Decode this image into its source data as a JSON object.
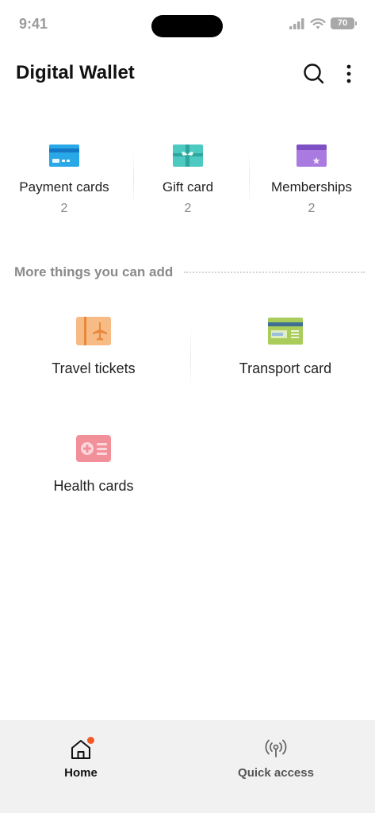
{
  "status_bar": {
    "time": "9:41",
    "battery": "70",
    "icons": [
      "signal-icon",
      "wifi-icon",
      "battery-icon"
    ]
  },
  "header": {
    "title": "Digital Wallet",
    "icons": [
      "search-icon",
      "more-vertical-icon"
    ]
  },
  "categories": [
    {
      "label": "Payment cards",
      "count": "2",
      "icon": "payment-card-icon",
      "color": "#29a8e8"
    },
    {
      "label": "Gift card",
      "count": "2",
      "icon": "gift-card-icon",
      "color": "#4cc9c0"
    },
    {
      "label": "Memberships",
      "count": "2",
      "icon": "membership-card-icon",
      "color": "#a97be0"
    }
  ],
  "more_section": {
    "title": "More things you can add",
    "items": [
      {
        "label": "Travel tickets",
        "icon": "travel-ticket-icon",
        "color": "#f7bb86"
      },
      {
        "label": "Transport card",
        "icon": "transport-card-icon",
        "color": "#a9cc5b"
      },
      {
        "label": "Health cards",
        "icon": "health-card-icon",
        "color": "#f2909a"
      }
    ]
  },
  "bottom_nav": {
    "items": [
      {
        "label": "Home",
        "icon": "home-icon",
        "active": true
      },
      {
        "label": "Quick access",
        "icon": "broadcast-icon",
        "active": false
      }
    ],
    "accent": "#f05a28"
  }
}
